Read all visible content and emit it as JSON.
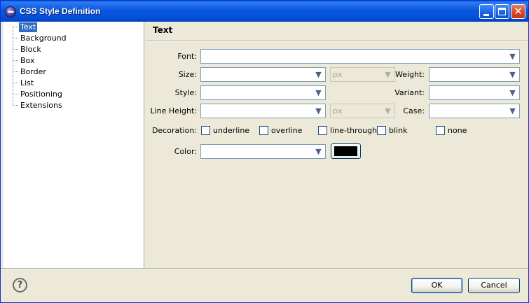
{
  "window": {
    "title": "CSS Style Definition",
    "close_glyph": "✕"
  },
  "tree": {
    "items": [
      "Text",
      "Background",
      "Block",
      "Box",
      "Border",
      "List",
      "Positioning",
      "Extensions"
    ],
    "selected": "Text"
  },
  "page": {
    "title": "Text"
  },
  "form": {
    "font_label": "Font:",
    "font_value": "",
    "size_label": "Size:",
    "size_value": "",
    "size_unit": "px",
    "weight_label": "Weight:",
    "weight_value": "",
    "style_label": "Style:",
    "style_value": "",
    "variant_label": "Variant:",
    "variant_value": "",
    "line_height_label": "Line Height:",
    "line_height_value": "",
    "line_height_unit": "px",
    "case_label": "Case:",
    "case_value": "",
    "decoration_label": "Decoration:",
    "decorations": [
      {
        "label": "underline",
        "checked": false
      },
      {
        "label": "overline",
        "checked": false
      },
      {
        "label": "line-through",
        "checked": false
      },
      {
        "label": "blink",
        "checked": false
      },
      {
        "label": "none",
        "checked": false
      }
    ],
    "color_label": "Color:",
    "color_value": "",
    "color_swatch": "#000000"
  },
  "buttons": {
    "help_glyph": "?",
    "ok": "OK",
    "cancel": "Cancel"
  },
  "colors": {
    "titlebar": "#0a58e0",
    "selection": "#316ac5",
    "dialog_bg": "#ece9d8"
  }
}
